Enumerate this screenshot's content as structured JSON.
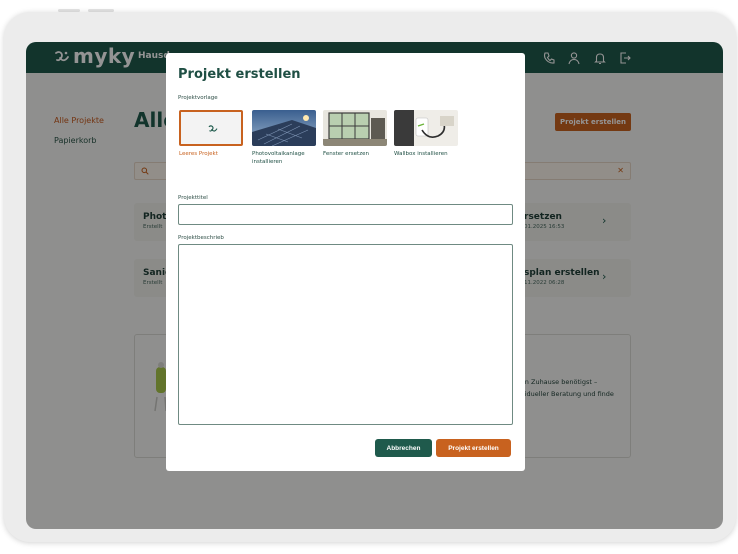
{
  "header": {
    "logo_text": "myky",
    "nav_first": "Hausd",
    "icons": [
      "phone-icon",
      "user-icon",
      "bell-icon",
      "logout-icon"
    ]
  },
  "background_page": {
    "sidebar": {
      "all_projects": "Alle Projekte",
      "trash": "Papierkorb"
    },
    "title": "Alle",
    "create_button": "Projekt erstellen",
    "cards": [
      {
        "left_title": "Photo",
        "left_sub": "Erstellt",
        "right_title": "rsetzen",
        "right_sub": "01.2025 16:53"
      },
      {
        "left_title": "Sanie",
        "left_sub": "Erstellt",
        "right_title": "splan erstellen",
        "right_sub": "11.2022 06:28"
      }
    ],
    "info": {
      "line1": "ein Zuhause benötigst –",
      "line2": "ividueller Beratung und finde"
    }
  },
  "modal": {
    "title": "Projekt erstellen",
    "template_label": "Projektvorlage",
    "templates": [
      {
        "label": "Leeres Projekt",
        "selected": true
      },
      {
        "label": "Photovoltaikanlage installieren",
        "selected": false
      },
      {
        "label": "Fenster ersetzen",
        "selected": false
      },
      {
        "label": "Wallbox installieren",
        "selected": false
      }
    ],
    "title_field_label": "Projekttitel",
    "title_field_value": "",
    "desc_field_label": "Projektbeschrieb",
    "desc_field_value": "",
    "cancel_button": "Abbrechen",
    "create_button": "Projekt erstellen"
  },
  "colors": {
    "primary": "#1f5a4c",
    "accent": "#c8621f"
  }
}
